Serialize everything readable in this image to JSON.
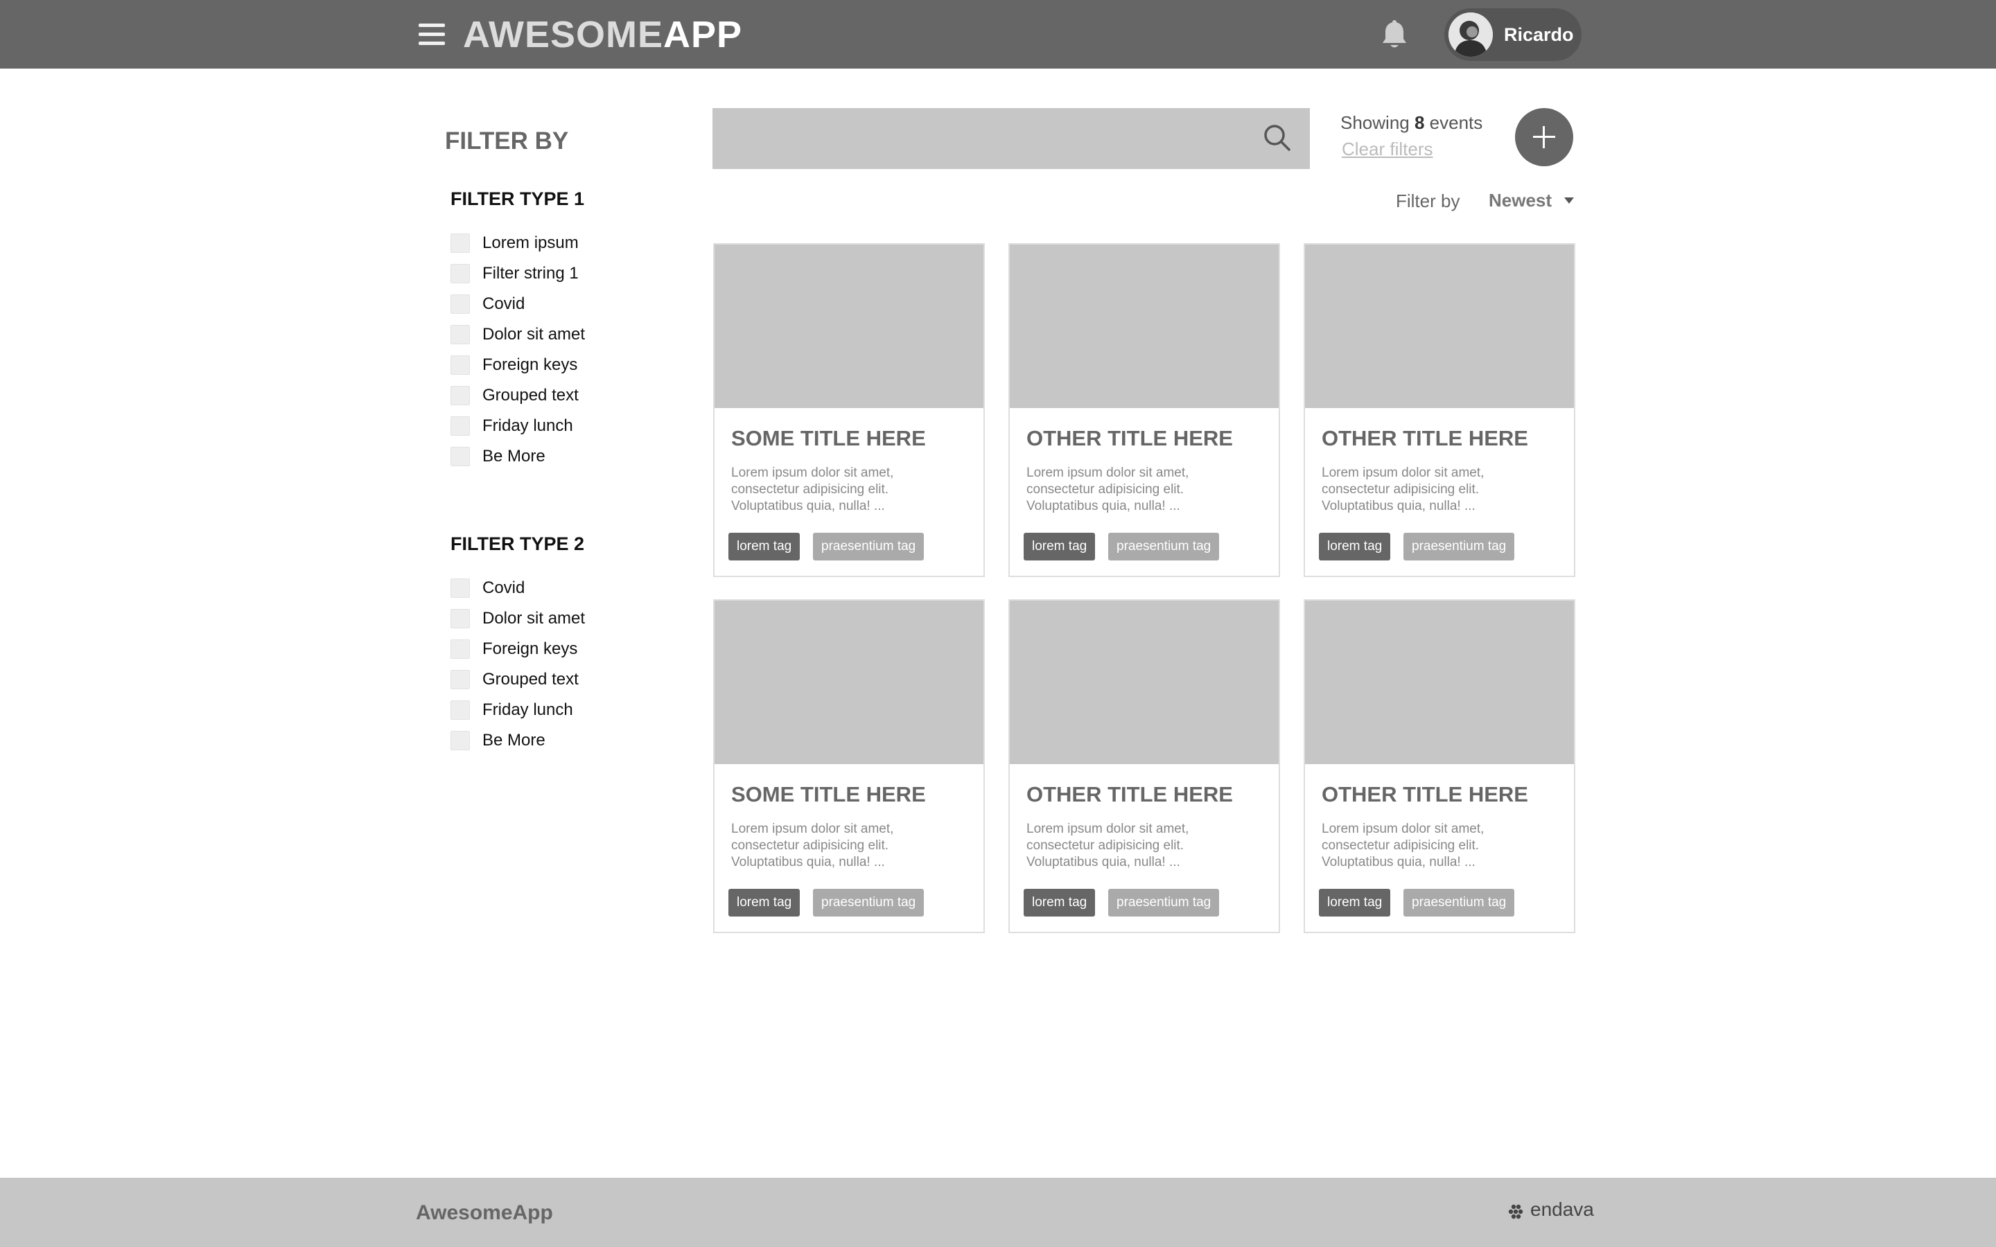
{
  "header": {
    "logo_part1": "AWESOME",
    "logo_part2": "APP",
    "user_name": "Ricardo",
    "icons": [
      "menu-icon",
      "bell-icon",
      "avatar"
    ]
  },
  "sidebar": {
    "title": "FILTER BY",
    "groups": [
      {
        "title": "FILTER TYPE 1",
        "items": [
          "Lorem ipsum",
          "Filter string 1",
          "Covid",
          "Dolor sit amet",
          "Foreign keys",
          "Grouped text",
          "Friday lunch",
          "Be More"
        ]
      },
      {
        "title": "FILTER TYPE 2",
        "items": [
          "Covid",
          "Dolor sit amet",
          "Foreign keys",
          "Grouped text",
          "Friday lunch",
          "Be More"
        ]
      }
    ]
  },
  "toolbar": {
    "search_placeholder": "",
    "showing_prefix": "Showing",
    "showing_count": "8",
    "showing_suffix": "events",
    "clear_filters": "Clear filters",
    "sort_label": "Filter by",
    "sort_value": "Newest"
  },
  "cards": [
    {
      "title": "SOME TITLE HERE",
      "desc_l1": "Lorem ipsum dolor sit amet,",
      "desc_l2": "consectetur adipisicing elit.",
      "desc_l3": "Voluptatibus quia, nulla! ...",
      "tag1": "lorem tag",
      "tag2": "praesentium tag"
    },
    {
      "title": "OTHER TITLE HERE",
      "desc_l1": "Lorem ipsum dolor sit amet,",
      "desc_l2": "consectetur adipisicing elit.",
      "desc_l3": "Voluptatibus quia, nulla! ...",
      "tag1": "lorem tag",
      "tag2": "praesentium tag"
    },
    {
      "title": "OTHER TITLE HERE",
      "desc_l1": "Lorem ipsum dolor sit amet,",
      "desc_l2": "consectetur adipisicing elit.",
      "desc_l3": "Voluptatibus quia, nulla! ...",
      "tag1": "lorem tag",
      "tag2": "praesentium tag"
    },
    {
      "title": "SOME TITLE HERE",
      "desc_l1": "Lorem ipsum dolor sit amet,",
      "desc_l2": "consectetur adipisicing elit.",
      "desc_l3": "Voluptatibus quia, nulla! ...",
      "tag1": "lorem tag",
      "tag2": "praesentium tag"
    },
    {
      "title": "OTHER TITLE HERE",
      "desc_l1": "Lorem ipsum dolor sit amet,",
      "desc_l2": "consectetur adipisicing elit.",
      "desc_l3": "Voluptatibus quia, nulla! ...",
      "tag1": "lorem tag",
      "tag2": "praesentium tag"
    },
    {
      "title": "OTHER TITLE HERE",
      "desc_l1": "Lorem ipsum dolor sit amet,",
      "desc_l2": "consectetur adipisicing elit.",
      "desc_l3": "Voluptatibus quia, nulla! ...",
      "tag1": "lorem tag",
      "tag2": "praesentium tag"
    }
  ],
  "footer": {
    "brand": "AwesomeApp",
    "partner_logo": "endava"
  },
  "colors": {
    "header_bg": "#666666",
    "placeholder_gray": "#c6c6c6",
    "tag_dark": "#666666",
    "tag_light": "#aaaaaa"
  }
}
